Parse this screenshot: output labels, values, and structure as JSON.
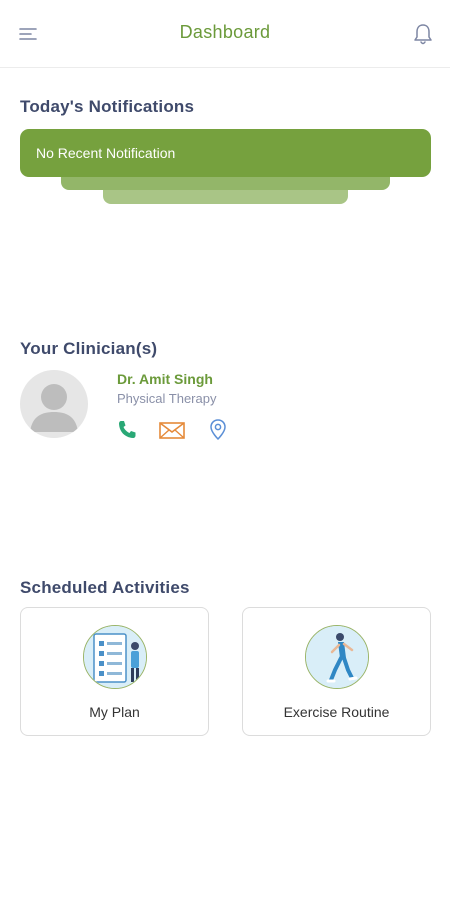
{
  "header": {
    "title": "Dashboard",
    "menu_icon": "menu-icon",
    "bell_icon": "bell-icon"
  },
  "notifications": {
    "section_title": "Today's Notifications",
    "message": "No Recent Notification"
  },
  "clinicians": {
    "section_title": "Your Clinician(s)",
    "items": [
      {
        "name": "Dr. Amit Singh",
        "specialty": "Physical Therapy",
        "phone_icon": "phone-icon",
        "email_icon": "email-icon",
        "location_icon": "location-pin-icon"
      }
    ]
  },
  "activities": {
    "section_title": "Scheduled Activities",
    "items": [
      {
        "label": "My Plan",
        "icon": "plan-checklist-icon"
      },
      {
        "label": "Exercise Routine",
        "icon": "exercise-runner-icon"
      }
    ]
  },
  "colors": {
    "brand_green": "#76a13e",
    "title_text": "#3f4a6b",
    "phone": "#2aa876",
    "email": "#e58a3a",
    "location": "#5b8fd6"
  }
}
